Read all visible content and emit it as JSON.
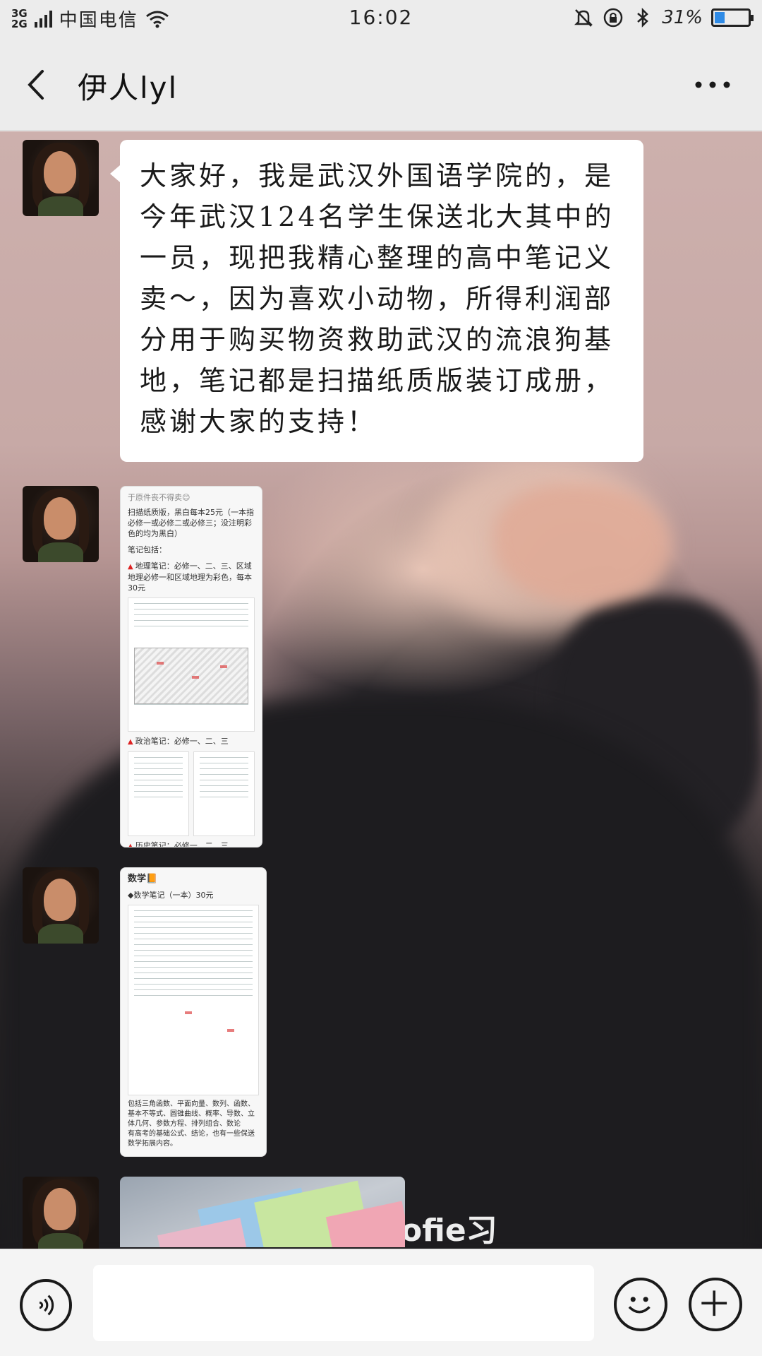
{
  "status_bar": {
    "network_top": "3G",
    "network_bottom": "2G",
    "carrier": "中国电信",
    "time": "16:02",
    "battery_percent": "31%",
    "battery_level": 0.31,
    "icons": [
      "signal-icon",
      "wifi-icon",
      "mute-bell-icon",
      "lock-rotation-icon",
      "bluetooth-icon",
      "battery-icon"
    ]
  },
  "header": {
    "back_icon": "chevron-left-icon",
    "title": "伊人lyl",
    "more_icon": "more-dots-icon"
  },
  "messages": [
    {
      "type": "text",
      "text": "大家好，我是武汉外国语学院的，是今年武汉124名学生保送北大其中的一员，现把我精心整理的高中笔记义卖～，因为喜欢小动物，所得利润部分用于购买物资救助武汉的流浪狗基地，笔记都是扫描纸质版装订成册，感谢大家的支持！"
    },
    {
      "type": "image",
      "lines": [
        "于原件丧不得卖😊",
        "扫描纸质版，黑白每本25元（一本指必修一或必修二或必修三；没注明彩色的均为黑白）",
        "笔记包括：",
        "地理笔记：必修一、二、三、区域地理必修一和区域地理为彩色，每本30元",
        "政治笔记：必修一、二、三",
        "历史笔记：必修一、二、三"
      ]
    },
    {
      "type": "image",
      "lines": [
        "数学📙",
        "◆数学笔记（一本）30元",
        "包括三角函数、平面向量、数列、函数、基本不等式、圆锥曲线、概率、导数、立体几何、参数方程、排列组合、数论",
        "有高考的基础公式、结论，也有一些保送数学拓展内容。"
      ]
    },
    {
      "type": "image",
      "lines": []
    }
  ],
  "background": {
    "watermark": "ofie习"
  },
  "input_bar": {
    "voice_icon": "voice-icon",
    "input_value": "",
    "emoji_icon": "emoji-icon",
    "plus_icon": "plus-icon"
  },
  "colors": {
    "bar_bg": "#ececec",
    "bubble_bg": "#ffffff",
    "battery_fill": "#2f8be6",
    "accent_red": "#dd2222"
  }
}
